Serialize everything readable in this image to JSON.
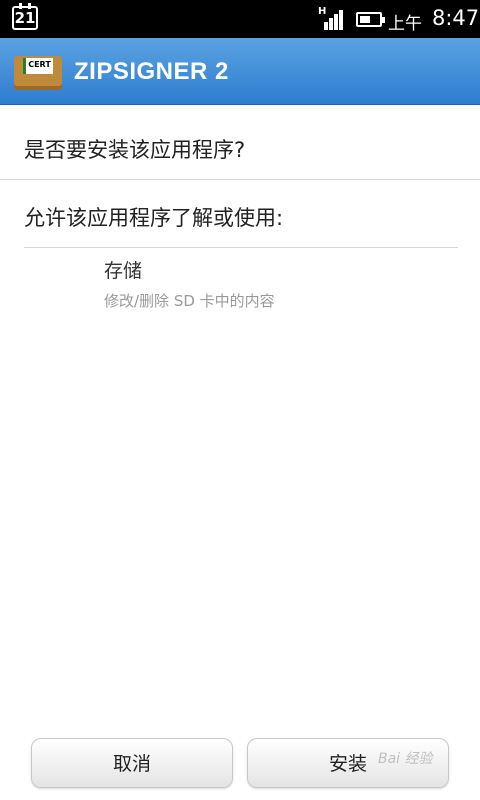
{
  "status_bar": {
    "calendar_day": "21",
    "network_type": "H",
    "ampm": "上午",
    "time": "8:47",
    "icons": [
      "calendar-icon",
      "signal-icon",
      "battery-icon"
    ]
  },
  "app_bar": {
    "title": "ZIPSIGNER 2",
    "icon_label": "CERT",
    "color": "#3a8ad8"
  },
  "content": {
    "question": "是否要安装该应用程序?",
    "allow_title": "允许该应用程序了解或使用:",
    "permissions": [
      {
        "name": "存储",
        "description": "修改/删除 SD 卡中的内容"
      }
    ]
  },
  "buttons": {
    "cancel": "取消",
    "install": "安装"
  },
  "watermark": "Bai 经验"
}
